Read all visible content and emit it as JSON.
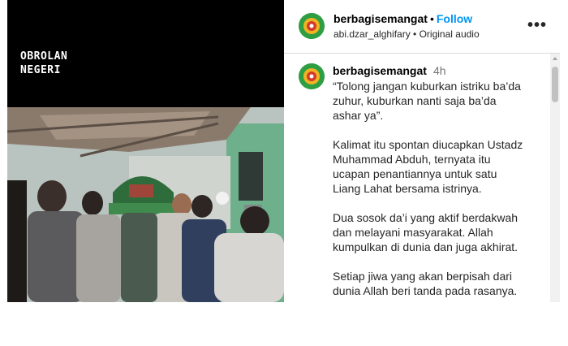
{
  "video": {
    "watermark_line1": "OBROLAN",
    "watermark_line2": "NEGERI"
  },
  "header": {
    "username": "berbagisemangat",
    "separator": "•",
    "follow_label": "Follow",
    "audio_credit": "abi.dzar_alghifary • Original audio",
    "more_icon": "more-horizontal-icon"
  },
  "comment": {
    "username": "berbagisemangat",
    "time": "4h",
    "caption": [
      "“Tolong jangan kuburkan istriku ba’da zuhur, kuburkan nanti saja ba’da ashar ya”.",
      "Kalimat itu spontan diucapkan Ustadz Muhammad Abduh, ternyata itu ucapan penantiannya untuk satu Liang Lahat bersama istrinya.",
      "Dua sosok da’i yang aktif berdakwah dan melayani masyarakat. Allah kumpulkan di dunia dan juga akhirat.",
      "Setiap jiwa yang akan berpisah dari dunia Allah beri tanda pada rasanya."
    ]
  },
  "colors": {
    "follow": "#0095f6",
    "avatar_bg": "#2e9e43",
    "avatar_accent": "#f0b323",
    "avatar_center": "#d23b2a"
  }
}
